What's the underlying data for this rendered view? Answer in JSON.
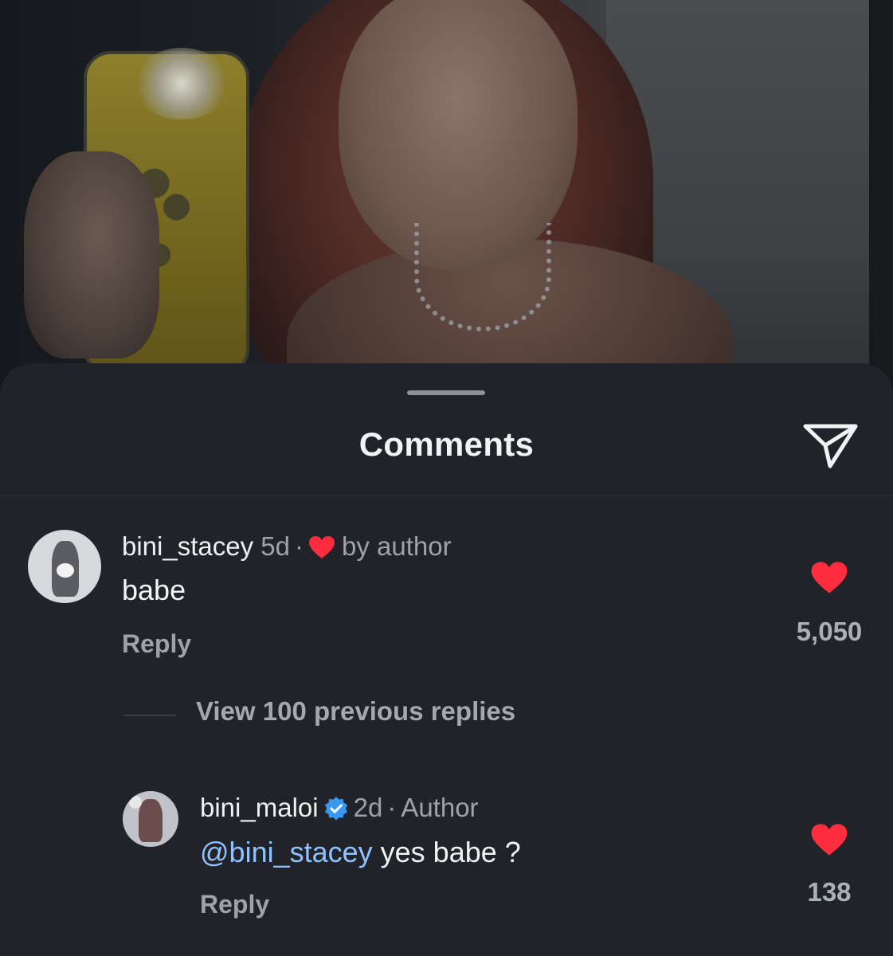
{
  "sheet": {
    "title": "Comments"
  },
  "comments": [
    {
      "username": "bini_stacey",
      "age": "5d",
      "separator": "·",
      "badge_text": "by author",
      "text": "babe",
      "reply_label": "Reply",
      "like_count": "5,050"
    }
  ],
  "thread": {
    "view_previous_label": "View 100 previous replies"
  },
  "replies": [
    {
      "username": "bini_maloi",
      "age": "2d",
      "separator": "·",
      "role": "Author",
      "mention": "@bini_stacey",
      "text": " yes babe ?",
      "reply_label": "Reply",
      "like_count": "138"
    }
  ],
  "colors": {
    "sheet_bg": "#212328",
    "like_red": "#ff2d3d",
    "mention_blue": "#8fc3ff",
    "verified_blue": "#3897f0"
  },
  "icons": {
    "share": "paper-plane-icon",
    "like": "heart-icon",
    "liked_by_author": "heart-icon",
    "verified": "verified-badge-icon"
  }
}
